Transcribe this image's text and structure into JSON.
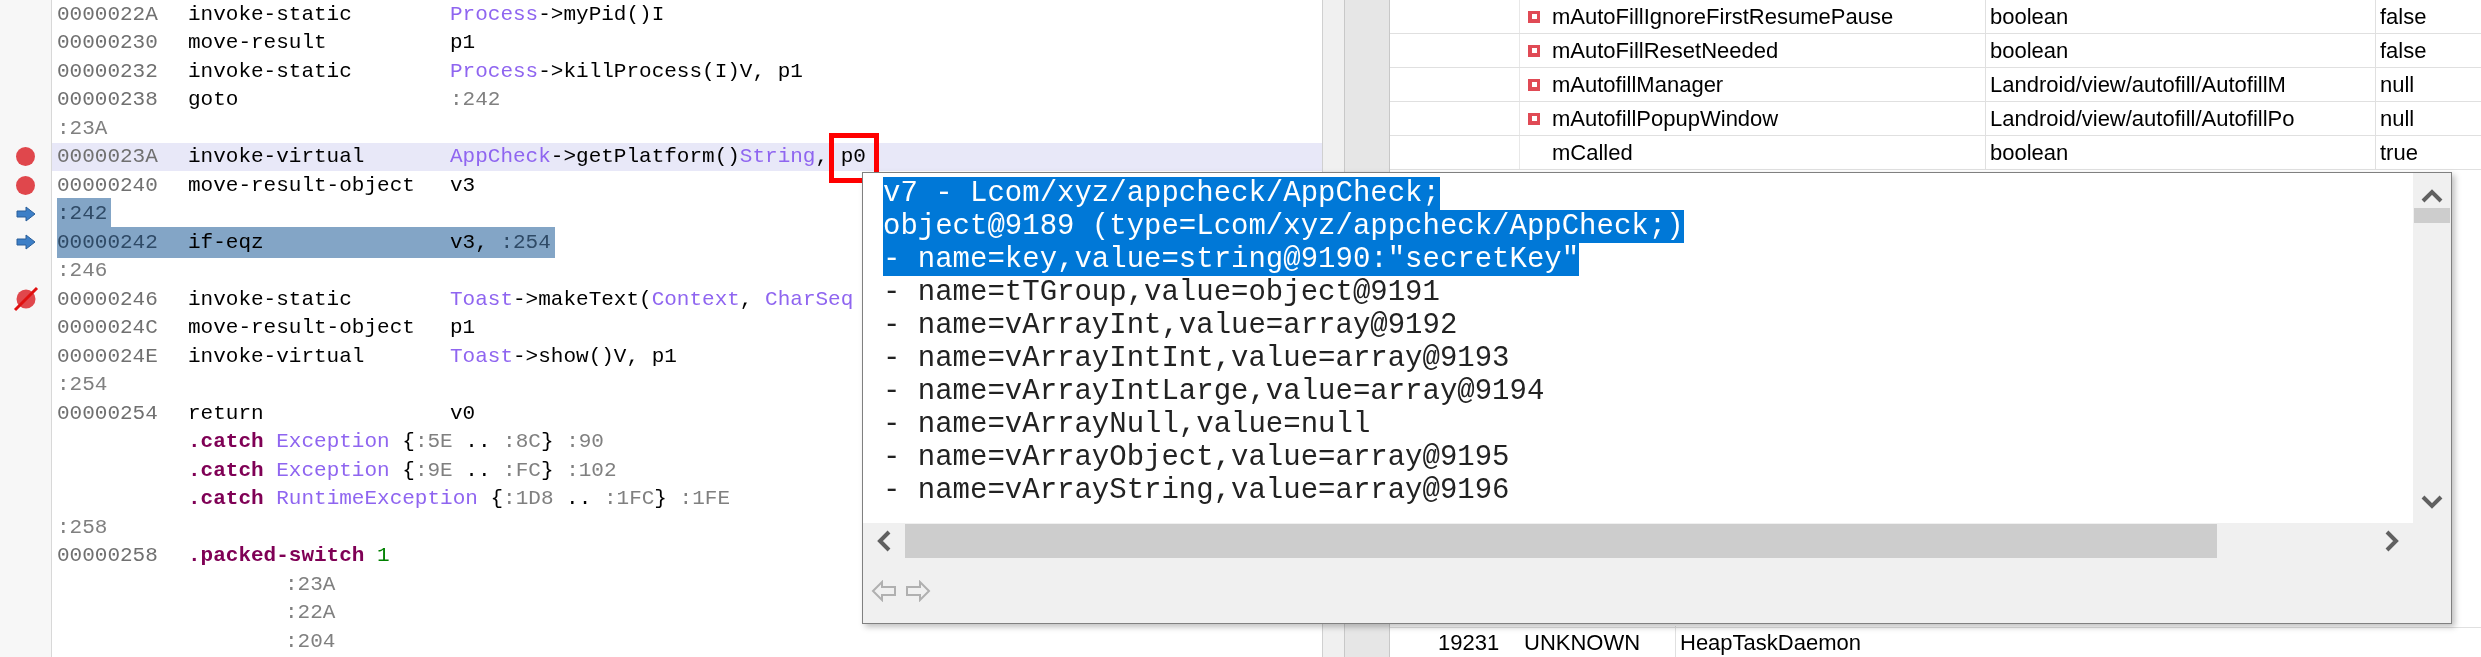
{
  "code_lines": [
    {
      "kind": "instr",
      "current": false,
      "selected": false,
      "address": "0000022A",
      "opcode": "invoke-static",
      "operand": [
        {
          "text": "Process",
          "kind": "type"
        },
        {
          "text": "->myPid()I",
          "kind": "plain"
        }
      ]
    },
    {
      "kind": "instr",
      "current": false,
      "selected": false,
      "address": "00000230",
      "opcode": "move-result",
      "operand": [
        {
          "text": "p1",
          "kind": "plain"
        }
      ]
    },
    {
      "kind": "instr",
      "current": false,
      "selected": false,
      "address": "00000232",
      "opcode": "invoke-static",
      "operand": [
        {
          "text": "Process",
          "kind": "type"
        },
        {
          "text": "->killProcess(I)V, p1",
          "kind": "plain"
        }
      ]
    },
    {
      "kind": "instr",
      "current": false,
      "selected": false,
      "address": "00000238",
      "opcode": "goto",
      "operand": [
        {
          "text": ":242",
          "kind": "label"
        }
      ]
    },
    {
      "kind": "label",
      "current": false,
      "selected": false,
      "text": ":23A"
    },
    {
      "kind": "instr",
      "breakpoint": true,
      "current": true,
      "selected": false,
      "address": "0000023A",
      "opcode": "invoke-virtual",
      "operand": [
        {
          "text": "AppCheck",
          "kind": "type"
        },
        {
          "text": "->getPlatform()",
          "kind": "plain"
        },
        {
          "text": "String",
          "kind": "type"
        },
        {
          "text": ",",
          "kind": "plain"
        },
        {
          "text": "p0",
          "kind": "plain",
          "boxed": true
        }
      ]
    },
    {
      "kind": "instr",
      "breakpoint": true,
      "current": false,
      "selected": false,
      "address": "00000240",
      "opcode": "move-result-object",
      "operand": [
        {
          "text": "v3",
          "kind": "plain"
        }
      ]
    },
    {
      "kind": "label",
      "execution_pointer": true,
      "current": false,
      "selected": true,
      "text": ":242"
    },
    {
      "kind": "instr",
      "execution_pointer": true,
      "current": false,
      "selected": true,
      "address": "00000242",
      "opcode": "if-eqz",
      "operand": [
        {
          "text": "v3,",
          "kind": "plain"
        },
        {
          "text": " :254",
          "kind": "label"
        }
      ]
    },
    {
      "kind": "label",
      "current": false,
      "selected": false,
      "text": ":246"
    },
    {
      "kind": "instr",
      "breakpoint": true,
      "breakpoint_disabled": true,
      "current": false,
      "selected": false,
      "address": "00000246",
      "opcode": "invoke-static",
      "operand": [
        {
          "text": "Toast",
          "kind": "type"
        },
        {
          "text": "->makeText(",
          "kind": "plain"
        },
        {
          "text": "Context",
          "kind": "type"
        },
        {
          "text": ",",
          "kind": "plain"
        },
        {
          "text": " CharSeq",
          "kind": "type"
        }
      ]
    },
    {
      "kind": "instr",
      "current": false,
      "selected": false,
      "address": "0000024C",
      "opcode": "move-result-object",
      "operand": [
        {
          "text": "p1",
          "kind": "plain"
        }
      ]
    },
    {
      "kind": "instr",
      "current": false,
      "selected": false,
      "address": "0000024E",
      "opcode": "invoke-virtual",
      "operand": [
        {
          "text": "Toast",
          "kind": "type"
        },
        {
          "text": "->show()V, p1",
          "kind": "plain"
        }
      ]
    },
    {
      "kind": "label",
      "current": false,
      "selected": false,
      "text": ":254"
    },
    {
      "kind": "instr",
      "current": false,
      "selected": false,
      "address": "00000254",
      "opcode": "return",
      "operand": [
        {
          "text": "v0",
          "kind": "plain"
        }
      ]
    },
    {
      "kind": "directive",
      "current": false,
      "selected": false,
      "parts": [
        {
          "text": ".catch",
          "kind": "directive"
        },
        {
          "text": " Exception",
          "kind": "type"
        },
        {
          "text": " {",
          "kind": "plain"
        },
        {
          "text": ":5E",
          "kind": "label"
        },
        {
          "text": " .. ",
          "kind": "plain"
        },
        {
          "text": ":8C",
          "kind": "label"
        },
        {
          "text": "}",
          "kind": "plain"
        },
        {
          "text": " :90",
          "kind": "label"
        }
      ]
    },
    {
      "kind": "directive",
      "current": false,
      "selected": false,
      "parts": [
        {
          "text": ".catch",
          "kind": "directive"
        },
        {
          "text": " Exception",
          "kind": "type"
        },
        {
          "text": " {",
          "kind": "plain"
        },
        {
          "text": ":9E",
          "kind": "label"
        },
        {
          "text": " .. ",
          "kind": "plain"
        },
        {
          "text": ":FC",
          "kind": "label"
        },
        {
          "text": "}",
          "kind": "plain"
        },
        {
          "text": " :102",
          "kind": "label"
        }
      ]
    },
    {
      "kind": "directive",
      "current": false,
      "selected": false,
      "parts": [
        {
          "text": ".catch",
          "kind": "directive"
        },
        {
          "text": " RuntimeException",
          "kind": "type"
        },
        {
          "text": " {",
          "kind": "plain"
        },
        {
          "text": ":1D8",
          "kind": "label"
        },
        {
          "text": " .. ",
          "kind": "plain"
        },
        {
          "text": ":1FC",
          "kind": "label"
        },
        {
          "text": "}",
          "kind": "plain"
        },
        {
          "text": " :1FE",
          "kind": "label"
        }
      ]
    },
    {
      "kind": "label",
      "current": false,
      "selected": false,
      "text": ":258"
    },
    {
      "kind": "instr",
      "current": false,
      "selected": false,
      "address": "00000258",
      "opcode_parts": [
        {
          "text": ".packed-switch",
          "kind": "directive"
        },
        {
          "text": " 1",
          "kind": "number"
        }
      ]
    },
    {
      "kind": "case",
      "current": false,
      "selected": false,
      "text": ":23A"
    },
    {
      "kind": "case",
      "current": false,
      "selected": false,
      "text": ":22A"
    },
    {
      "kind": "case",
      "current": false,
      "selected": false,
      "text": ":204"
    }
  ],
  "fields_table": {
    "rows": [
      {
        "private": true,
        "name": "mAutoFillIgnoreFirstResumePause",
        "type": "boolean",
        "value": "false"
      },
      {
        "private": true,
        "name": "mAutoFillResetNeeded",
        "type": "boolean",
        "value": "false"
      },
      {
        "private": true,
        "name": "mAutofillManager",
        "type": "Landroid/view/autofill/AutofillM",
        "value": "null"
      },
      {
        "private": true,
        "name": "mAutofillPopupWindow",
        "type": "Landroid/view/autofill/AutofillPo",
        "value": "null"
      },
      {
        "private": false,
        "name": "mCalled",
        "type": "boolean",
        "value": "true"
      }
    ]
  },
  "threads_table": {
    "rows": [
      {
        "column_1": "19231",
        "column_2": "UNKNOWN",
        "column_3": "HeapTaskDaemon"
      }
    ]
  },
  "value_popup": {
    "lines": [
      {
        "text": "v7 - Lcom/xyz/appcheck/AppCheck;",
        "selected": true
      },
      {
        "text": "object@9189 (type=Lcom/xyz/appcheck/AppCheck;)",
        "selected": true
      },
      {
        "text": "- name=key,value=string@9190:\"secretKey\"",
        "selected": true
      },
      {
        "text": "- name=tTGroup,value=object@9191",
        "selected": false
      },
      {
        "text": "- name=vArrayInt,value=array@9192",
        "selected": false
      },
      {
        "text": "- name=vArrayIntInt,value=array@9193",
        "selected": false
      },
      {
        "text": "- name=vArrayIntLarge,value=array@9194",
        "selected": false
      },
      {
        "text": "- name=vArrayNull,value=null",
        "selected": false
      },
      {
        "text": "- name=vArrayObject,value=array@9195",
        "selected": false
      },
      {
        "text": "- name=vArrayString,value=array@9196",
        "selected": false
      }
    ]
  }
}
